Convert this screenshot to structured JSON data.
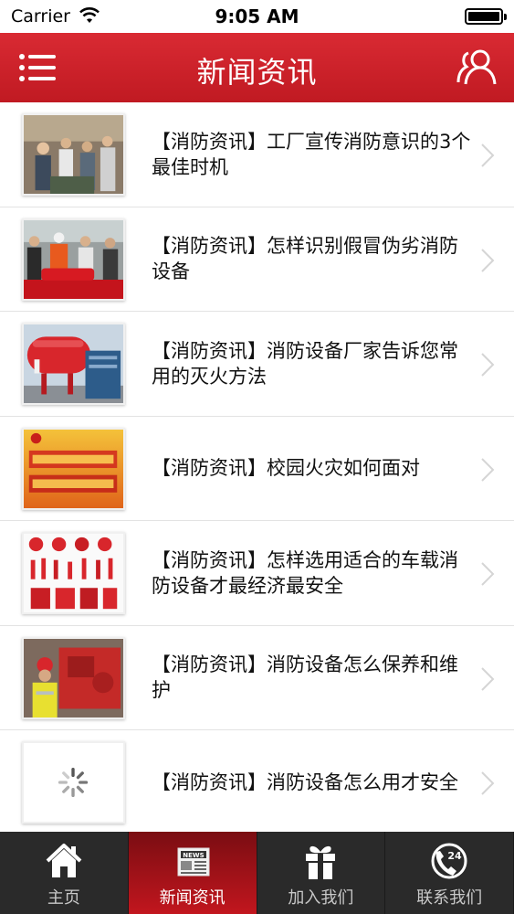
{
  "status_bar": {
    "carrier": "Carrier",
    "time": "9:05 AM"
  },
  "header": {
    "title": "新闻资讯",
    "left_icon": "menu-icon",
    "right_icon": "user-icon"
  },
  "news": [
    {
      "title": "【消防资讯】工厂宣传消防意识的3个最佳时机",
      "thumbnail": "people-photo"
    },
    {
      "title": "【消防资讯】怎样识别假冒伪劣消防设备",
      "thumbnail": "extinguisher-demo-photo"
    },
    {
      "title": "【消防资讯】消防设备厂家告诉您常用的灭火方法",
      "thumbnail": "pressure-tank-photo"
    },
    {
      "title": "【消防资讯】校园火灾如何面对",
      "thumbnail": "campus-fire-poster"
    },
    {
      "title": "【消防资讯】怎样选用适合的车载消防设备才最经济最安全",
      "thumbnail": "equipment-catalog"
    },
    {
      "title": "【消防资讯】消防设备怎么保养和维护",
      "thumbnail": "worker-pump-photo"
    },
    {
      "title": "【消防资讯】消防设备怎么用才安全",
      "thumbnail": "loading-spinner"
    }
  ],
  "tabs": [
    {
      "label": "主页",
      "icon": "home-icon",
      "active": false
    },
    {
      "label": "新闻资讯",
      "icon": "newspaper-icon",
      "active": true
    },
    {
      "label": "加入我们",
      "icon": "gift-icon",
      "active": false
    },
    {
      "label": "联系我们",
      "icon": "phone-24-icon",
      "active": false
    }
  ],
  "colors": {
    "nav": "#c8202a",
    "tab_bar": "#2a2a2a",
    "tab_active": "#c2161e"
  }
}
